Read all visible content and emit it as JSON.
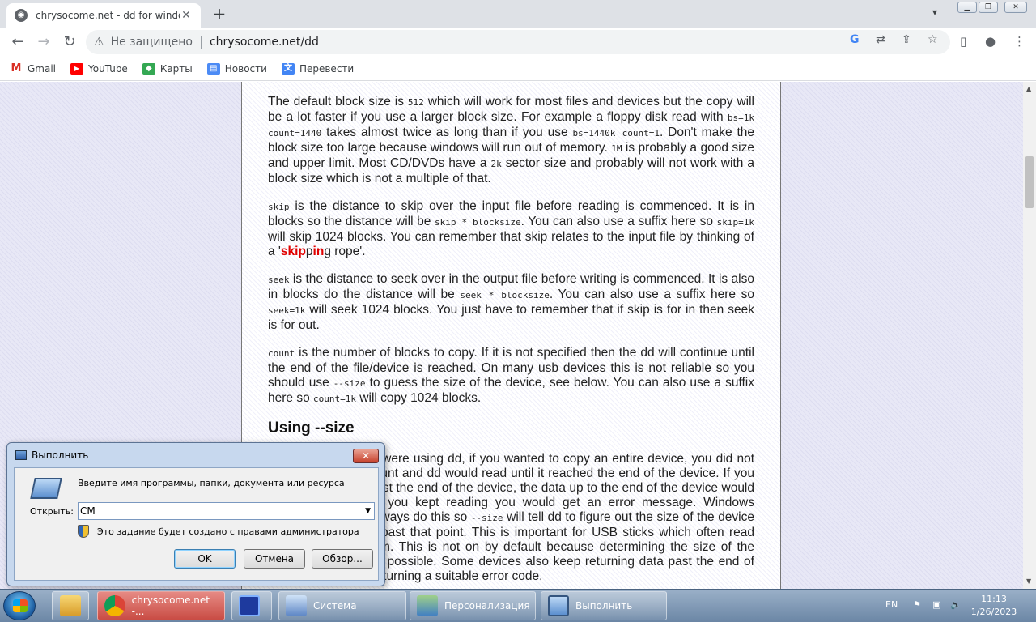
{
  "browser": {
    "tab_title": "chrysocome.net - dd for windows",
    "security_label": "Не защищено",
    "url": "chrysocome.net/dd",
    "bookmarks": [
      "Gmail",
      "YouTube",
      "Карты",
      "Новости",
      "Перевести"
    ]
  },
  "article": {
    "p1": {
      "t1": "The default block size is ",
      "c1": "512",
      "t2": " which will work for most files and devices but the copy will be a lot faster if you use a larger block size. For example a floppy disk read with ",
      "c2": "bs=1k count=1440",
      "t3": " takes almost twice as long than if you use ",
      "c3": "bs=1440k count=1",
      "t4": ". Don't make the block size too large because windows will run out of memory. ",
      "c4": "1M",
      "t5": " is probably a good size and upper limit. Most CD/DVDs have a ",
      "c5": "2k",
      "t6": " sector size and probably will not work with a block size which is not a multiple of that."
    },
    "p2": {
      "c1": "skip",
      "t1": " is the distance to skip over the input file before reading is commenced. It is in blocks so the distance will be ",
      "c2": "skip * blocksize",
      "t2": ". You can also use a suffix here so ",
      "c3": "skip=1k",
      "t3": " will skip 1024 blocks. You can remember that skip relates to the input file by thinking of a '",
      "r1": "skip",
      "t4": "p",
      "r2": "in",
      "t5": "g rope'."
    },
    "p3": {
      "c1": "seek",
      "t1": " is the distance to seek over in the output file before writing is commenced. It is also in blocks do the distance will be ",
      "c2": "seek * blocksize",
      "t2": ". You can also use a suffix here so ",
      "c3": "seek=1k",
      "t3": " will seek 1024 blocks. You just have to remember that if skip is for in then seek is for out."
    },
    "p4": {
      "c1": "count",
      "t1": " is the number of blocks to copy. If it is not specified then the dd will continue until the end of the file/device is reached. On many usb devices this is not reliable so you should use ",
      "c2": "--size",
      "t2": " to guess the size of the device, see below. You can also use a suffix here so ",
      "c3": "count=1k",
      "t3": " will copy 1024 blocks."
    },
    "heading": "Using --size",
    "p5": {
      "t1": "Before --size, if you were using dd, if you wanted to copy an entire device, you did not have to specify a count and dd would read until it reached the end of the device. If you continued to read past the end of the device, the data up to the end of the device would be returned, and if you kept reading you would get an error message. Windows however does not always do this so ",
      "c1": "--size",
      "t2": " will tell dd to figure out the size of the device and try not to read past that point. This is important for USB sticks which often read past the end of them. This is not on by default because determining the size of the device is not always possible. Some devices also keep returning data past the end of the device without returning a suitable error code."
    }
  },
  "run_dialog": {
    "title": "Выполнить",
    "description": "Введите имя программы, папки, документа или ресурса",
    "open_label": "Открыть:",
    "input_value": "CM",
    "admin_note": "Это задание будет создано с правами администратора",
    "ok": "OK",
    "cancel": "Отмена",
    "browse": "Обзор..."
  },
  "taskbar": {
    "items": [
      "chrysocome.net -...",
      "Система",
      "Персонализация",
      "Выполнить"
    ],
    "language": "EN",
    "time": "11:13",
    "date": "1/26/2023"
  },
  "colors": {
    "highlight_red": "#e00000",
    "page_bg": "#e8e8f6",
    "dialog_frame": "#c7d8ee"
  }
}
